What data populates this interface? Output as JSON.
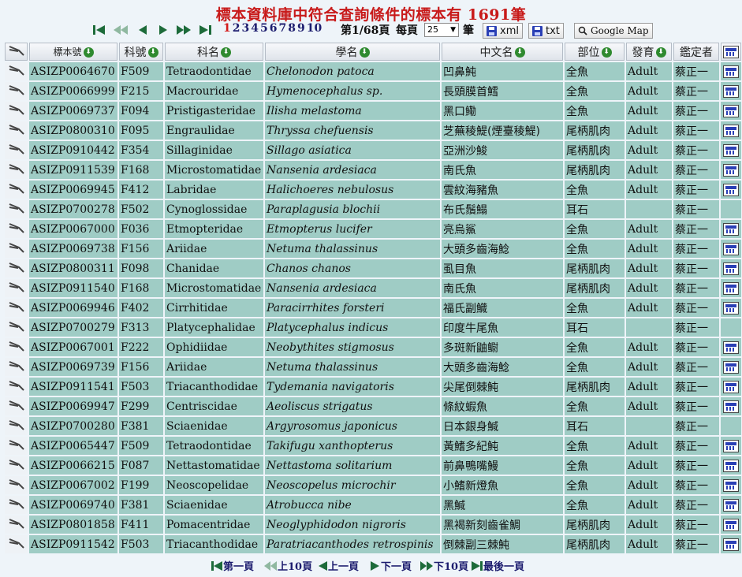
{
  "title": "標本資料庫中符合查詢條件的標本有 1691筆",
  "pagination": {
    "pages": [
      "1",
      "2",
      "3",
      "4",
      "5",
      "6",
      "7",
      "8",
      "9",
      "10"
    ],
    "current": "1",
    "page_info": "第1/68頁",
    "per_page_label": "每頁",
    "per_page_value": "25",
    "per_page_unit": "筆"
  },
  "export": {
    "xml_label": "xml",
    "txt_label": "txt",
    "map_label": "Google Map"
  },
  "columns": {
    "catalog_no": "標本號",
    "family_code": "科號",
    "family": "科名",
    "scientific_name": "學名",
    "chinese_name": "中文名",
    "part": "部位",
    "stage": "發育",
    "identifier": "鑑定者"
  },
  "rows": [
    {
      "no": "ASIZP0064670",
      "code": "F509",
      "family": "Tetraodontidae",
      "sci": "Chelonodon patoca",
      "zh": "凹鼻魨",
      "part": "全魚",
      "stage": "Adult",
      "id": "蔡正一",
      "img": true
    },
    {
      "no": "ASIZP0066999",
      "code": "F215",
      "family": "Macrouridae",
      "sci": "Hymenocephalus sp.",
      "zh": "長頭膜首鱈",
      "part": "全魚",
      "stage": "Adult",
      "id": "蔡正一",
      "img": true
    },
    {
      "no": "ASIZP0069737",
      "code": "F094",
      "family": "Pristigasteridae",
      "sci": "Ilisha melastoma",
      "zh": "黑口鰳",
      "part": "全魚",
      "stage": "Adult",
      "id": "蔡正一",
      "img": true
    },
    {
      "no": "ASIZP0800310",
      "code": "F095",
      "family": "Engraulidae",
      "sci": "Thryssa chefuensis",
      "zh": "芝蕪稜鯷(煙臺稜鯷)",
      "part": "尾柄肌肉",
      "stage": "Adult",
      "id": "蔡正一",
      "img": true
    },
    {
      "no": "ASIZP0910442",
      "code": "F354",
      "family": "Sillaginidae",
      "sci": "Sillago asiatica",
      "zh": "亞洲沙鮻",
      "part": "尾柄肌肉",
      "stage": "Adult",
      "id": "蔡正一",
      "img": true
    },
    {
      "no": "ASIZP0911539",
      "code": "F168",
      "family": "Microstomatidae",
      "sci": "Nansenia ardesiaca",
      "zh": "南氏魚",
      "part": "尾柄肌肉",
      "stage": "Adult",
      "id": "蔡正一",
      "img": true
    },
    {
      "no": "ASIZP0069945",
      "code": "F412",
      "family": "Labridae",
      "sci": "Halichoeres nebulosus",
      "zh": "雲紋海豬魚",
      "part": "全魚",
      "stage": "Adult",
      "id": "蔡正一",
      "img": true
    },
    {
      "no": "ASIZP0700278",
      "code": "F502",
      "family": "Cynoglossidae",
      "sci": "Paraplagusia blochii",
      "zh": "布氏鬚鰨",
      "part": "耳石",
      "stage": "",
      "id": "蔡正一",
      "img": false
    },
    {
      "no": "ASIZP0067000",
      "code": "F036",
      "family": "Etmopteridae",
      "sci": "Etmopterus lucifer",
      "zh": "亮烏鯊",
      "part": "全魚",
      "stage": "Adult",
      "id": "蔡正一",
      "img": true
    },
    {
      "no": "ASIZP0069738",
      "code": "F156",
      "family": "Ariidae",
      "sci": "Netuma thalassinus",
      "zh": "大頭多齒海鯰",
      "part": "全魚",
      "stage": "Adult",
      "id": "蔡正一",
      "img": true
    },
    {
      "no": "ASIZP0800311",
      "code": "F098",
      "family": "Chanidae",
      "sci": "Chanos chanos",
      "zh": "虱目魚",
      "part": "尾柄肌肉",
      "stage": "Adult",
      "id": "蔡正一",
      "img": true
    },
    {
      "no": "ASIZP0911540",
      "code": "F168",
      "family": "Microstomatidae",
      "sci": "Nansenia ardesiaca",
      "zh": "南氏魚",
      "part": "尾柄肌肉",
      "stage": "Adult",
      "id": "蔡正一",
      "img": true
    },
    {
      "no": "ASIZP0069946",
      "code": "F402",
      "family": "Cirrhitidae",
      "sci": "Paracirrhites forsteri",
      "zh": "福氏副鱵",
      "part": "全魚",
      "stage": "Adult",
      "id": "蔡正一",
      "img": true
    },
    {
      "no": "ASIZP0700279",
      "code": "F313",
      "family": "Platycephalidae",
      "sci": "Platycephalus indicus",
      "zh": "印度牛尾魚",
      "part": "耳石",
      "stage": "",
      "id": "蔡正一",
      "img": false
    },
    {
      "no": "ASIZP0067001",
      "code": "F222",
      "family": "Ophidiidae",
      "sci": "Neobythites stigmosus",
      "zh": "多斑新鼬鳚",
      "part": "全魚",
      "stage": "Adult",
      "id": "蔡正一",
      "img": true
    },
    {
      "no": "ASIZP0069739",
      "code": "F156",
      "family": "Ariidae",
      "sci": "Netuma thalassinus",
      "zh": "大頭多齒海鯰",
      "part": "全魚",
      "stage": "Adult",
      "id": "蔡正一",
      "img": true
    },
    {
      "no": "ASIZP0911541",
      "code": "F503",
      "family": "Triacanthodidae",
      "sci": "Tydemania navigatoris",
      "zh": "尖尾倒棘魨",
      "part": "尾柄肌肉",
      "stage": "Adult",
      "id": "蔡正一",
      "img": true
    },
    {
      "no": "ASIZP0069947",
      "code": "F299",
      "family": "Centriscidae",
      "sci": "Aeoliscus strigatus",
      "zh": "條紋蝦魚",
      "part": "全魚",
      "stage": "Adult",
      "id": "蔡正一",
      "img": true
    },
    {
      "no": "ASIZP0700280",
      "code": "F381",
      "family": "Sciaenidae",
      "sci": "Argyrosomus japonicus",
      "zh": "日本銀身鰔",
      "part": "耳石",
      "stage": "",
      "id": "蔡正一",
      "img": false
    },
    {
      "no": "ASIZP0065447",
      "code": "F509",
      "family": "Tetraodontidae",
      "sci": "Takifugu xanthopterus",
      "zh": "黃鰭多紀魨",
      "part": "全魚",
      "stage": "Adult",
      "id": "蔡正一",
      "img": true
    },
    {
      "no": "ASIZP0066215",
      "code": "F087",
      "family": "Nettastomatidae",
      "sci": "Nettastoma solitarium",
      "zh": "前鼻鴨嘴鰻",
      "part": "全魚",
      "stage": "Adult",
      "id": "蔡正一",
      "img": true
    },
    {
      "no": "ASIZP0067002",
      "code": "F199",
      "family": "Neoscopelidae",
      "sci": "Neoscopelus microchir",
      "zh": "小鰭新燈魚",
      "part": "全魚",
      "stage": "Adult",
      "id": "蔡正一",
      "img": true
    },
    {
      "no": "ASIZP0069740",
      "code": "F381",
      "family": "Sciaenidae",
      "sci": "Atrobucca nibe",
      "zh": "黑鰔",
      "part": "全魚",
      "stage": "Adult",
      "id": "蔡正一",
      "img": true
    },
    {
      "no": "ASIZP0801858",
      "code": "F411",
      "family": "Pomacentridae",
      "sci": "Neoglyphidodon nigroris",
      "zh": "黑褐新刻齒雀鯛",
      "part": "尾柄肌肉",
      "stage": "Adult",
      "id": "蔡正一",
      "img": true
    },
    {
      "no": "ASIZP0911542",
      "code": "F503",
      "family": "Triacanthodidae",
      "sci": "Paratriacanthodes retrospinis",
      "zh": "倒棘副三棘魨",
      "part": "尾柄肌肉",
      "stage": "Adult",
      "id": "蔡正一",
      "img": true
    }
  ],
  "footer": {
    "first": "第一頁",
    "prev10": "上10頁",
    "prev": "上一頁",
    "next": "下一頁",
    "next10": "下10頁",
    "last": "最後一頁"
  },
  "icons": {
    "tool": "tweezers-icon",
    "sort": "sort-down-icon",
    "image": "image-icon"
  }
}
